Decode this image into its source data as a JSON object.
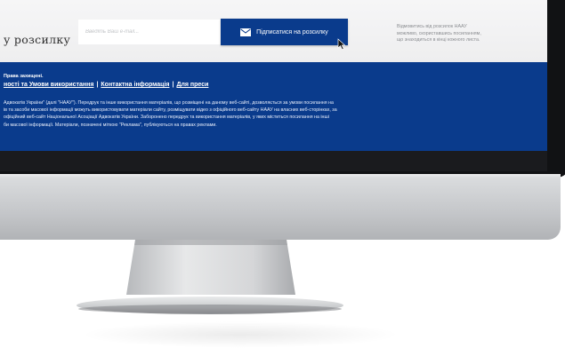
{
  "subscription": {
    "title": "у розсилку",
    "email_placeholder": "Введіть Ваш e-mail...",
    "button_label": "Підписатися на розсилку",
    "unsubscribe_note": [
      "Відмовитись від розсилок НААУ",
      "можливо, скориставшись посиланням,",
      "що знаходиться в кінці кожного листа."
    ]
  },
  "footer": {
    "copyright": "Права захищені.",
    "links": [
      "ності та Умови використання",
      "Контактна інформація",
      "Для преси"
    ],
    "link_separator": "|",
    "legal_lines": [
      "Адвокатів України\" (далі \"НААУ\"). Передрук та інше використання матеріалів, що розміщені на даному веб-сайті, дозволяється за умови посилання на",
      "ів та засоби масової інформації можуть використовувати матеріали сайту, розміщувати відео з офіційного веб-сайту НААУ на власних веб-сторінках, за",
      "офіційний веб-сайт Національної Асоціації Адвокатів України. Заборонено передрук та використання матеріалів, у яких міститься посилання на інші",
      "би масової інформації. Матеріали, позначені міткою \"Реклама\", публікуються на правах реклами."
    ]
  },
  "colors": {
    "brand_blue": "#0a3b8c",
    "bezel": "#111214",
    "chin_silver": "#c4c6c9"
  },
  "icons": {
    "mail": "mail-icon",
    "cursor": "cursor-icon"
  }
}
